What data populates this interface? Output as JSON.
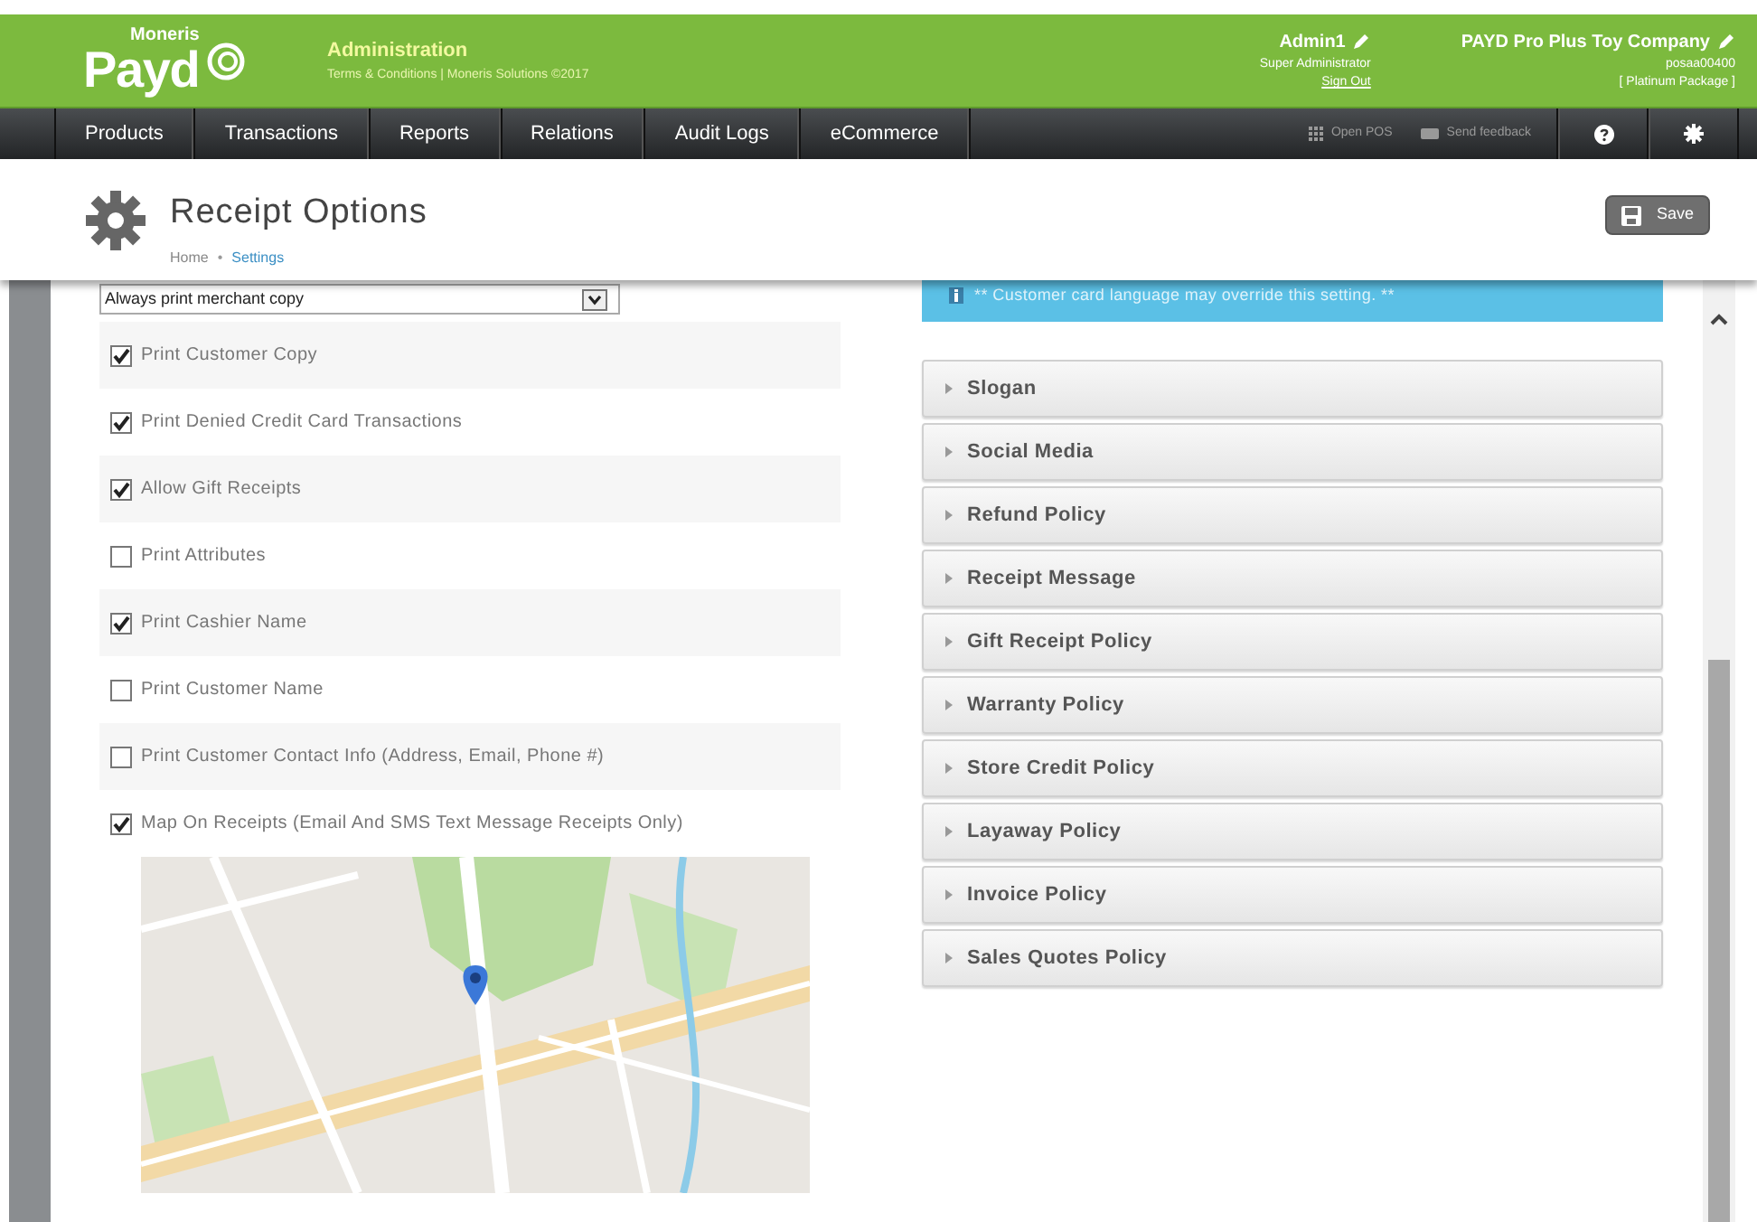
{
  "header": {
    "logo_small": "Moneris",
    "logo": "Payd",
    "app_title": "Administration",
    "app_subtitle": "Terms & Conditions | Moneris Solutions ©2017",
    "user": {
      "name": "Admin1",
      "role": "Super Administrator",
      "sign_out": "Sign Out"
    },
    "company": {
      "name": "PAYD Pro Plus Toy Company",
      "id": "posaa00400",
      "package": "[ Platinum Package ]"
    }
  },
  "nav": {
    "items": [
      "Products",
      "Transactions",
      "Reports",
      "Relations",
      "Audit Logs",
      "eCommerce"
    ],
    "open_pos": "Open POS",
    "send_feedback": "Send feedback"
  },
  "page": {
    "title": "Receipt Options",
    "breadcrumb_separator": "•",
    "breadcrumb": [
      {
        "label": "Home",
        "link": false
      },
      {
        "label": "Settings",
        "link": true
      }
    ],
    "save": "Save"
  },
  "merchant_copy_select": {
    "value": "Always print merchant copy"
  },
  "options": [
    {
      "label": "Print Customer Copy",
      "checked": true
    },
    {
      "label": "Print Denied Credit Card Transactions",
      "checked": true
    },
    {
      "label": "Allow Gift Receipts",
      "checked": true
    },
    {
      "label": "Print Attributes",
      "checked": false
    },
    {
      "label": "Print Cashier Name",
      "checked": true
    },
    {
      "label": "Print Customer Name",
      "checked": false
    },
    {
      "label": "Print Customer Contact Info (Address, Email, Phone #)",
      "checked": false
    },
    {
      "label": "Map On Receipts (Email And SMS Text Message Receipts Only)",
      "checked": true
    }
  ],
  "info_banner": "** Customer card language may override this setting. **",
  "sections": [
    {
      "label": "Slogan",
      "expanded": false
    },
    {
      "label": "Social Media",
      "expanded": false
    },
    {
      "label": "Refund Policy",
      "expanded": false
    },
    {
      "label": "Receipt Message",
      "expanded": false
    },
    {
      "label": "Gift Receipt Policy",
      "expanded": false
    },
    {
      "label": "Warranty Policy",
      "expanded": false
    },
    {
      "label": "Store Credit Policy",
      "expanded": false
    },
    {
      "label": "Layaway Policy",
      "expanded": false
    },
    {
      "label": "Invoice Policy",
      "expanded": false
    },
    {
      "label": "Sales Quotes Policy",
      "expanded": false
    }
  ]
}
